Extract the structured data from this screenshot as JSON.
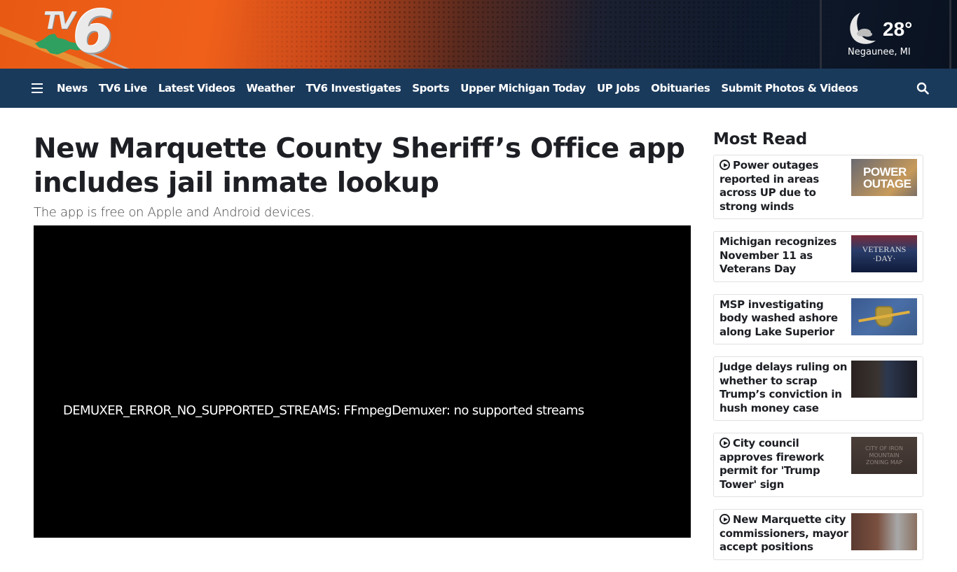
{
  "brand": {
    "logo_text_tv": "TV",
    "logo_text_num": "6",
    "primary_color": "#1a3a5c",
    "accent_color": "#f0601a"
  },
  "weather": {
    "icon": "moon-cloud-icon",
    "temperature": "28°",
    "location": "Negaunee, MI"
  },
  "nav": {
    "menu_icon": "hamburger-menu-icon",
    "items": [
      {
        "label": "News"
      },
      {
        "label": "TV6 Live"
      },
      {
        "label": "Latest Videos"
      },
      {
        "label": "Weather"
      },
      {
        "label": "TV6 Investigates"
      },
      {
        "label": "Sports"
      },
      {
        "label": "Upper Michigan Today"
      },
      {
        "label": "UP Jobs"
      },
      {
        "label": "Obituaries"
      },
      {
        "label": "Submit Photos & Videos"
      }
    ],
    "search_icon": "search-icon"
  },
  "article": {
    "headline": "New Marquette County Sheriff’s Office app includes jail inmate lookup",
    "subheadline": "The app is free on Apple and Android devices.",
    "video_error": "DEMUXER_ERROR_NO_SUPPORTED_STREAMS: FFmpegDemuxer: no supported streams"
  },
  "most_read": {
    "title": "Most Read",
    "items": [
      {
        "title": "Power outages reported in areas across UP due to strong winds",
        "video": true,
        "thumb_text": "POWER OUTAGE"
      },
      {
        "title": "Michigan recognizes November 11 as Veterans Day",
        "video": false,
        "thumb_text": "VETERANS ·DAY·"
      },
      {
        "title": "MSP investigating body washed ashore along Lake Superior",
        "video": false,
        "thumb_text": ""
      },
      {
        "title": "Judge delays ruling on whether to scrap Trump’s conviction in hush money case",
        "video": false,
        "thumb_text": ""
      },
      {
        "title": "City council approves firework permit for 'Trump Tower' sign",
        "video": true,
        "thumb_text": "CITY OF IRON MOUNTAIN ZONING MAP"
      },
      {
        "title": "New Marquette city commissioners, mayor accept positions",
        "video": true,
        "thumb_text": ""
      }
    ]
  }
}
